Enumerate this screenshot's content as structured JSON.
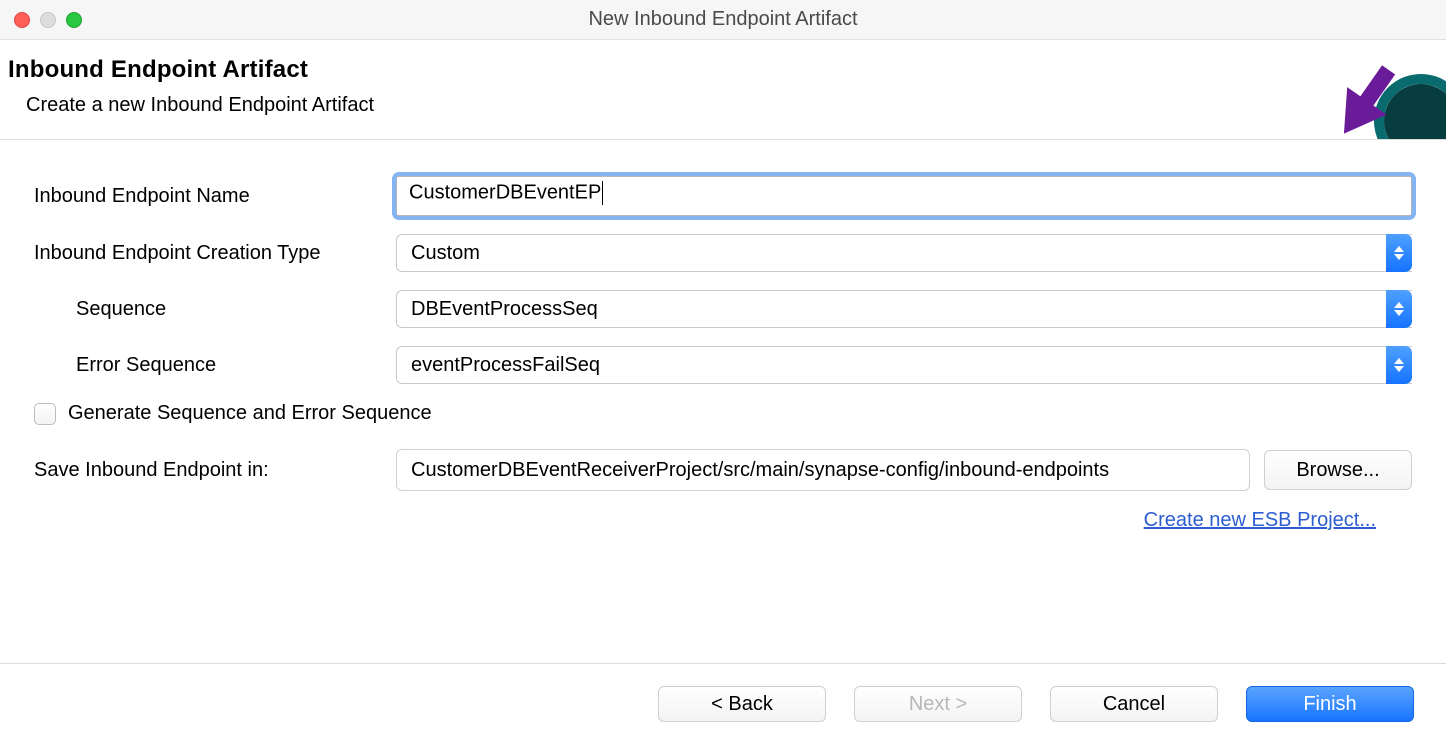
{
  "window": {
    "title": "New Inbound Endpoint Artifact"
  },
  "header": {
    "title": "Inbound Endpoint Artifact",
    "subtitle": "Create a new Inbound Endpoint Artifact"
  },
  "form": {
    "name_label": "Inbound Endpoint Name",
    "name_value": "CustomerDBEventEP",
    "type_label": "Inbound Endpoint Creation Type",
    "type_value": "Custom",
    "sequence_label": "Sequence",
    "sequence_value": "DBEventProcessSeq",
    "error_sequence_label": "Error Sequence",
    "error_sequence_value": "eventProcessFailSeq",
    "generate_label": "Generate Sequence and Error Sequence",
    "generate_checked": false,
    "save_label": "Save Inbound Endpoint in:",
    "save_value": "CustomerDBEventReceiverProject/src/main/synapse-config/inbound-endpoints",
    "browse_label": "Browse...",
    "create_project_link": "Create new ESB Project..."
  },
  "footer": {
    "back": "< Back",
    "next": "Next >",
    "cancel": "Cancel",
    "finish": "Finish"
  },
  "colors": {
    "accent_blue": "#1875ff",
    "icon_teal": "#0a6b6e",
    "arrow_purple": "#6a1b9a"
  }
}
